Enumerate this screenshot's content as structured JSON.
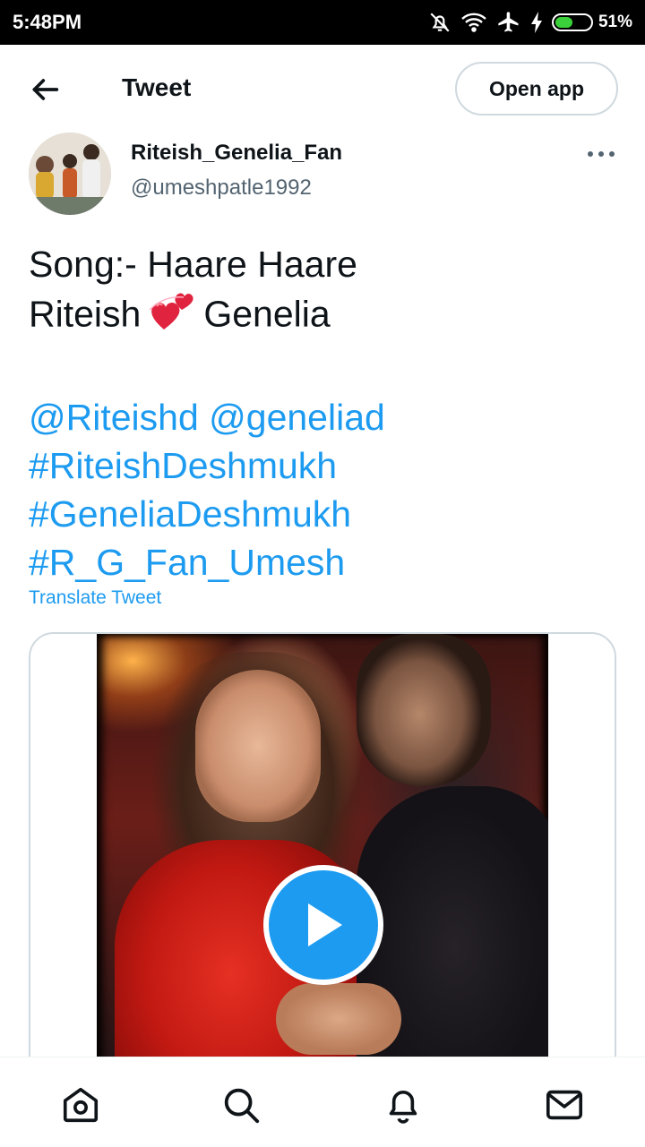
{
  "status_bar": {
    "time": "5:48PM",
    "battery": "51%",
    "battery_level": 0.51,
    "icons": [
      "bell-muted-icon",
      "wifi-icon",
      "airplane-icon",
      "charging-icon",
      "battery-icon"
    ]
  },
  "header": {
    "back_icon": "arrow-left-icon",
    "title": "Tweet",
    "open_app_label": "Open app"
  },
  "author": {
    "name": "Riteish_Genelia_Fan",
    "handle": "@umeshpatle1992",
    "more_icon": "more-horizontal-icon"
  },
  "tweet": {
    "line1": "Song:- Haare Haare",
    "line2_a": "Riteish",
    "line2_emoji": "two-hearts-emoji",
    "line2_b": "Genelia",
    "mention1": "@Riteishd",
    "mention2": "@geneliad",
    "hashtag1": "#RiteishDeshmukh",
    "hashtag2": "#GeneliaDeshmukh",
    "hashtag3": "#R_G_Fan_Umesh",
    "translate": "Translate Tweet"
  },
  "media": {
    "type": "video",
    "play_icon": "play-icon"
  },
  "bottom_nav": {
    "items": [
      "home-icon",
      "search-icon",
      "notifications-icon",
      "messages-icon"
    ]
  },
  "colors": {
    "accent": "#1d9bf0",
    "text": "#0f1419",
    "secondary": "#536471",
    "border": "#cfd9de"
  }
}
